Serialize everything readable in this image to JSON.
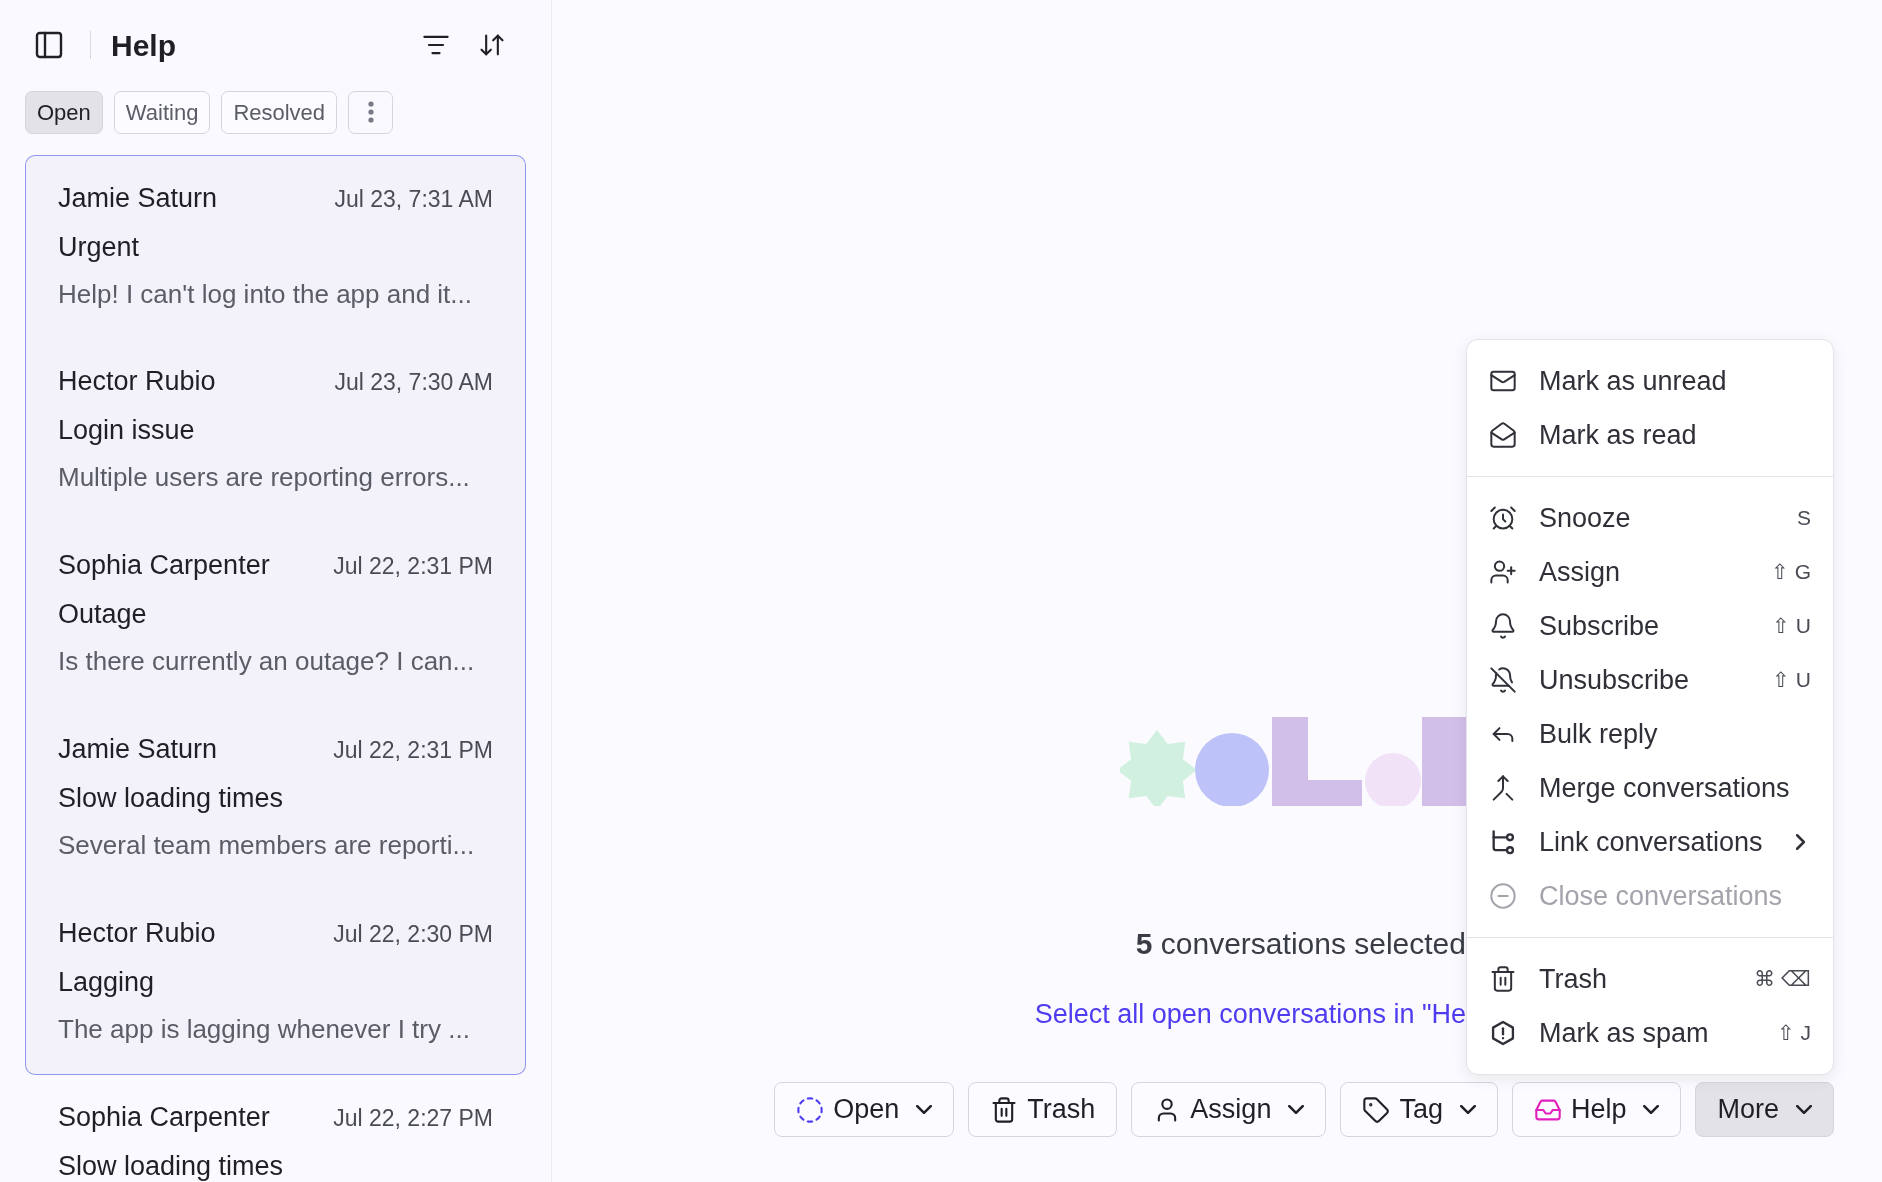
{
  "sidebar": {
    "title": "Help",
    "filters": [
      {
        "label": "Open",
        "selected": true
      },
      {
        "label": "Waiting",
        "selected": false
      },
      {
        "label": "Resolved",
        "selected": false
      }
    ],
    "conversations": [
      {
        "name": "Jamie Saturn",
        "time": "Jul 23, 7:31 AM",
        "subject": "Urgent",
        "preview": "Help! I can't log into the app and it...",
        "selected": true
      },
      {
        "name": "Hector Rubio",
        "time": "Jul 23, 7:30 AM",
        "subject": "Login issue",
        "preview": "Multiple users are reporting errors...",
        "selected": true
      },
      {
        "name": "Sophia Carpenter",
        "time": "Jul 22, 2:31 PM",
        "subject": "Outage",
        "preview": "Is there currently an outage? I can...",
        "selected": true
      },
      {
        "name": "Jamie Saturn",
        "time": "Jul 22, 2:31 PM",
        "subject": "Slow loading times",
        "preview": "Several team members are reporti...",
        "selected": true
      },
      {
        "name": "Hector Rubio",
        "time": "Jul 22, 2:30 PM",
        "subject": "Lagging",
        "preview": "The app is lagging whenever I try ...",
        "selected": true
      },
      {
        "name": "Sophia Carpenter",
        "time": "Jul 22, 2:27 PM",
        "subject": "Slow loading times",
        "selected": false
      }
    ]
  },
  "main": {
    "selection_text": "**5** conversations selected",
    "select_all_link": "Select all open conversations in \"He"
  },
  "menu": {
    "groups": [
      [
        {
          "label": "Mark as unread",
          "disabled": false,
          "submenu": false
        },
        {
          "label": "Mark as read",
          "disabled": false,
          "submenu": false
        }
      ],
      [
        {
          "label": "Snooze",
          "shortcut": "S",
          "disabled": false,
          "submenu": false
        },
        {
          "label": "Assign",
          "shortcut": "⇧ G",
          "disabled": false,
          "submenu": false
        },
        {
          "label": "Subscribe",
          "shortcut": "⇧ U",
          "disabled": false,
          "submenu": false
        },
        {
          "label": "Unsubscribe",
          "shortcut": "⇧ U",
          "disabled": false,
          "submenu": false
        },
        {
          "label": "Bulk reply",
          "disabled": false,
          "submenu": false
        },
        {
          "label": "Merge conversations",
          "disabled": false,
          "submenu": false
        },
        {
          "label": "Link conversations",
          "disabled": false,
          "submenu": true
        },
        {
          "label": "Close conversations",
          "disabled": true,
          "submenu": false
        }
      ],
      [
        {
          "label": "Trash",
          "shortcut": "⌘ ⌫",
          "disabled": false,
          "submenu": false
        },
        {
          "label": "Mark as spam",
          "shortcut": "⇧ J",
          "disabled": false,
          "submenu": false
        }
      ]
    ]
  },
  "actions": [
    {
      "label": "Open",
      "dropdown": true,
      "selected": false
    },
    {
      "label": "Trash",
      "dropdown": false,
      "selected": false
    },
    {
      "label": "Assign",
      "dropdown": true,
      "selected": false
    },
    {
      "label": "Tag",
      "dropdown": true,
      "selected": false
    },
    {
      "label": "Help",
      "dropdown": true,
      "selected": false
    },
    {
      "label": "More",
      "dropdown": true,
      "selected": true
    }
  ]
}
